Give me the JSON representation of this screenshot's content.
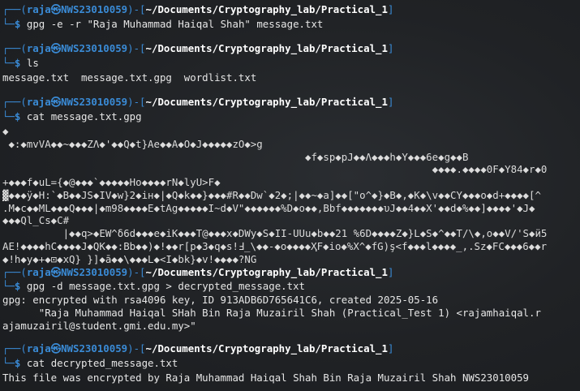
{
  "colors": {
    "background": "#1f2124",
    "prompt": "#3a8bd6",
    "path": "#ffffff",
    "text": "#e6e6e6"
  },
  "prompt": {
    "user": "raja",
    "at_symbol": "㉿",
    "host": "NWS23010059",
    "path": "~/Documents/Cryptography_lab/Practical_1",
    "dollar": "$"
  },
  "blocks": [
    {
      "command": "gpg -e -r \"Raja Muhammad Haiqal Shah\" message.txt",
      "output": []
    },
    {
      "command": "ls",
      "output": [
        "message.txt  message.txt.gpg  wordlist.txt"
      ]
    },
    {
      "command": "cat message.txt.gpg",
      "output": [
        "◆",
        " ◆:◆mvVA◆◆~◆◆◆ZΛ◆'◆◆Q◆t}Ae◆◆A◆O◆J◆◆◆◆◆zO◆>g",
        "                                                  ◆f◆sp◆pJ◆◆Λ◆◆◆h◆Y◆◆◆6e◆g◆◆B",
        "                                                                       ◆◆◆◆.◆◆◆◆0F◆Y84◆r◆0",
        "+◆◆◆f◆uL={◆@◆◆◆`◆◆◆◆◆Ho◆◆◆◆rN◆lyU>F◆",
        "▓◆◆◆ÿ◆H:`◆B◆◆JS◆IV◆w}2◆iн◆|◆Q◆k◆◆}◆◆◆#R◆◆Dw`◆2◆;|◆◆~◆a]◆◆[\"o^◆}◆B◆,◆K◆\\v◆◆CY◆◆◆o◆d+◆◆◆◆[^",
        ".M◆c◆◆ML◆◆◆Q◆◆◆|◆m98◆◆◆◆E◆tAg◆◆◆◆◆I~d◆V\"◆◆◆◆◆◆%D◆o◆◆,Bbf◆◆◆◆◆◆◆υJ◆◆4◆◆X'◆◆d◆%◆◆]◆◆◆◆'◆J◆",
        "◆◆◆Ql_Cs◆C#",
        "          |◆◆q>◆EW^δ6d◆◆◆e◆iK◆◆◆T@◆◆◆x◆DWy◆S◆II-UUu◆b◆◆21 %6D◆◆◆◆Z◆}L◆S◆^◆◆T/\\◆,o◆◆V/'S◆ӥ5",
        "AE!◆◆◆◆hC◆◆◆◆J◆QK◆◆:Bb◆◆)◆!◆◆r[p◆3◆q◆s!Ⅎ_\\◆◆-◆o◆◆◆◆ҲF◆io◆%X^◆fG)ş<f◆◆◆l◆◆◆◆_,.Sz◆FC◆◆◆6◆◆r",
        "◆!h◆y◆+◆⊡◆xQ} }]◆ā◆◆\\◆◆◆L◆<I◆bk}◆v!◆◆◆◆?NG"
      ]
    },
    {
      "command": "gpg -d message.txt.gpg > decrypted_message.txt",
      "output": [
        "gpg: encrypted with rsa4096 key, ID 913ADB6D765641C6, created 2025-05-16",
        "      \"Raja Muhammad Haiqal SHah Bin Raja Muzairil Shah (Practical_Test 1) <rajamhaiqal.r",
        "ajamuzairil@student.gmi.edu.my>\""
      ]
    },
    {
      "command": "cat decrypted_message.txt",
      "output": [
        "This file was encrypted by Raja Muhammad Haiqal Shah Bin Raja Muzairil Shah NWS23010059"
      ]
    }
  ]
}
